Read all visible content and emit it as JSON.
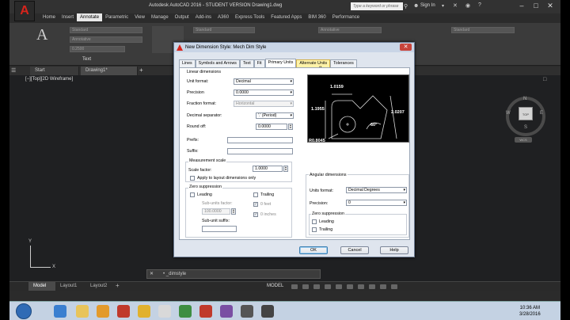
{
  "app": {
    "title": "Autodesk AutoCAD 2016 - STUDENT VERSION     Drawing1.dwg",
    "search_placeholder": "Type a keyword or phrase",
    "sign_in": "Sign In",
    "logo_letter": "A"
  },
  "ribbon": {
    "tabs": [
      "Home",
      "Insert",
      "Annotate",
      "Parametric",
      "View",
      "Manage",
      "Output",
      "Add-ins",
      "A360",
      "Express Tools",
      "Featured Apps",
      "BIM 360",
      "Performance"
    ],
    "active_tab": "Annotate",
    "fields": [
      "Standard",
      "Annotative",
      "0.2500",
      "Standard",
      "Annotative",
      "Standard"
    ],
    "panel_label": "Text"
  },
  "doc_tabs": [
    "Start",
    "Drawing1*"
  ],
  "viewport_label": "[−][Top][2D Wireframe]",
  "viewcube": {
    "face": "TOP",
    "n": "N",
    "s": "S",
    "e": "E",
    "w": "W",
    "wcs": "WCS"
  },
  "axis": {
    "x": "X",
    "y": "Y"
  },
  "command_line": "• _dimstyle",
  "layout_tabs": [
    "Model",
    "Layout1",
    "Layout2"
  ],
  "status": {
    "model": "MODEL"
  },
  "clock": {
    "time": "10:36 AM",
    "date": "3/28/2016"
  },
  "dialog": {
    "title": "New Dimension Style: Mech Dim Style",
    "tabs": [
      "Lines",
      "Symbols and Arrows",
      "Text",
      "Fit",
      "Primary Units",
      "Alternate Units",
      "Tolerances"
    ],
    "active_tab": "Primary Units",
    "linear": {
      "heading": "Linear dimensions",
      "unit_format_label": "Unit format:",
      "unit_format": "Decimal",
      "precision_label": "Precision",
      "precision": "0.0000",
      "fraction_label": "Fraction format:",
      "fraction": "Horizontal",
      "decimal_sep_label": "Decimal separator:",
      "decimal_sep": "'.' (Period)",
      "roundoff_label": "Round off:",
      "roundoff": "0.0000",
      "prefix_label": "Prefix:",
      "suffix_label": "Suffix:"
    },
    "measurement": {
      "heading": "Measurement scale",
      "scale_label": "Scale factor:",
      "scale": "1.0000",
      "apply_layout": "Apply to layout dimensions only"
    },
    "zero": {
      "heading": "Zero suppression",
      "leading": "Leading",
      "trailing": "Trailing",
      "subunits_factor_label": "Sub-units factor:",
      "subunits_factor": "100.0000",
      "feet": "0 feet",
      "inches": "0 inches",
      "subunit_suffix_label": "Sub-unit suffix:"
    },
    "angular": {
      "heading": "Angular dimensions",
      "units_label": "Units format:",
      "units": "Decimal Degrees",
      "precision_label": "Precision:",
      "precision": "0",
      "zero_heading": "Zero suppression",
      "leading": "Leading",
      "trailing": "Trailing"
    },
    "preview": {
      "d1": "1.0159",
      "d2": "1.1955",
      "d3": "2.0207",
      "angle": "60°",
      "radius": "R0.8045"
    },
    "buttons": {
      "ok": "OK",
      "cancel": "Cancel",
      "help": "Help"
    }
  },
  "colors": {
    "accent": "#d8241c",
    "ribbon_bg": "#3b3b3b",
    "canvas": "#1f2022",
    "dialog_bg": "#dfe5ee"
  }
}
